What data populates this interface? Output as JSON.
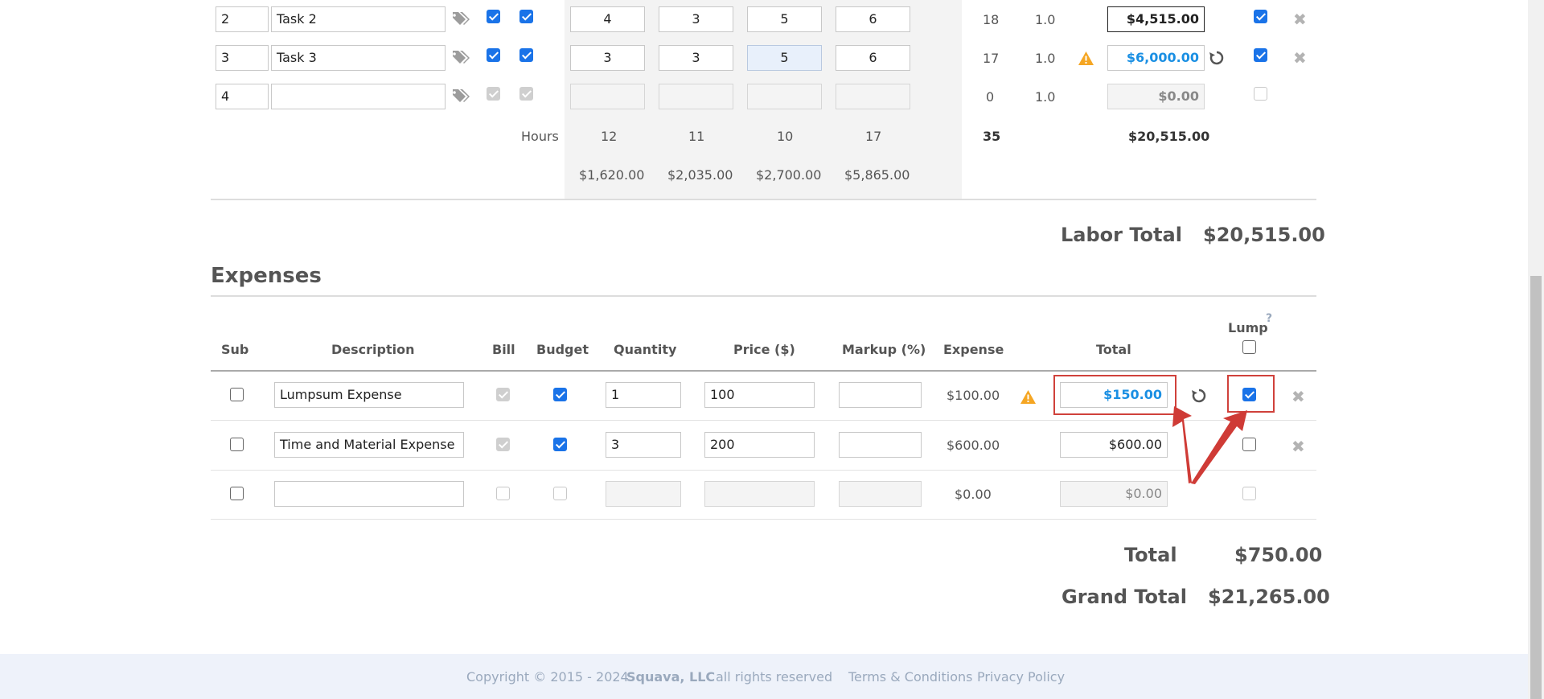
{
  "labor": {
    "rows": [
      {
        "num": "2",
        "name": "Task 2",
        "h1": "4",
        "h2": "3",
        "h3": "5",
        "h4": "6",
        "hours": "18",
        "rate": "1.0",
        "total": "$4,515.00"
      },
      {
        "num": "3",
        "name": "Task 3",
        "h1": "3",
        "h2": "3",
        "h3": "5",
        "h4": "6",
        "hours": "17",
        "rate": "1.0",
        "total": "$6,000.00"
      },
      {
        "num": "4",
        "name": "",
        "h1": "",
        "h2": "",
        "h3": "",
        "h4": "",
        "hours": "0",
        "rate": "1.0",
        "total": "$0.00"
      }
    ],
    "hours_label": "Hours",
    "hours_totals": [
      "12",
      "11",
      "10",
      "17"
    ],
    "hours_sum": "35",
    "cost_totals": [
      "$1,620.00",
      "$2,035.00",
      "$2,700.00",
      "$5,865.00"
    ],
    "grand": "$20,515.00",
    "labor_total_label": "Labor Total",
    "labor_total_value": "$20,515.00"
  },
  "expenses": {
    "title": "Expenses",
    "headers": {
      "sub": "Sub",
      "description": "Description",
      "bill": "Bill",
      "budget": "Budget",
      "quantity": "Quantity",
      "price": "Price ($)",
      "markup": "Markup (%)",
      "expense": "Expense",
      "total": "Total",
      "lump": "Lump",
      "help": "?"
    },
    "rows": [
      {
        "description": "Lumpsum Expense",
        "quantity": "1",
        "price": "100",
        "markup": "",
        "expense": "$100.00",
        "total": "$150.00"
      },
      {
        "description": "Time and Material Expense",
        "quantity": "3",
        "price": "200",
        "markup": "",
        "expense": "$600.00",
        "total": "$600.00"
      },
      {
        "description": "",
        "quantity": "",
        "price": "",
        "markup": "",
        "expense": "$0.00",
        "total": "$0.00"
      }
    ],
    "total_label": "Total",
    "total_value": "$750.00",
    "grand_total_label": "Grand Total",
    "grand_total_value": "$21,265.00"
  },
  "footer": {
    "copyright": "Copyright © 2015 - 2024",
    "company": "Squava, LLC",
    "rights": "all rights reserved",
    "terms": "Terms & Conditions",
    "privacy": "Privacy Policy"
  },
  "colors": {
    "accent": "#1a73e8",
    "link_blue": "#1a8fe3",
    "warning": "#f5a623",
    "annotation_red": "#d0413b",
    "footer_bg": "#eef2fa"
  }
}
